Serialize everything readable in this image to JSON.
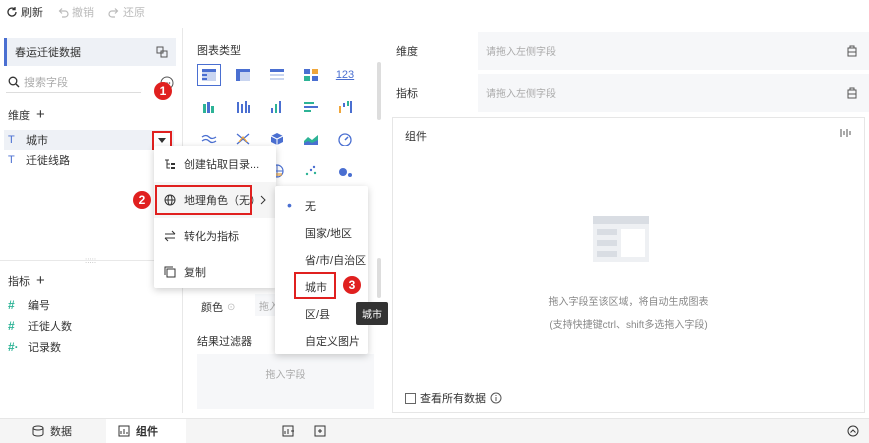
{
  "toolbar": {
    "refresh": "刷新",
    "undo": "撤销",
    "redo": "还原"
  },
  "left": {
    "dataset": "春运迁徙数据",
    "search_placeholder": "搜索字段",
    "dimension_label": "维度",
    "dimensions": [
      "城市",
      "迁徙线路"
    ],
    "metric_label": "指标",
    "metrics": [
      {
        "type": "#",
        "name": "编号"
      },
      {
        "type": "#",
        "name": "迁徙人数"
      },
      {
        "type": "#·",
        "name": "记录数"
      }
    ]
  },
  "chart": {
    "title": "图表类型",
    "color_label": "颜色",
    "drag_short": "拖入",
    "result_filter": "结果过滤器",
    "drag_field": "拖入字段",
    "number_icon": "123"
  },
  "config": {
    "dimension": "维度",
    "metric": "指标",
    "placeholder": "请拖入左侧字段",
    "component": "组件",
    "empty_hint": "拖入字段至该区域，将自动生成图表",
    "empty_hint2": "(支持快捷键ctrl、shift多选拖入字段)",
    "view_all": "查看所有数据"
  },
  "menu": {
    "items": [
      "创建钻取目录...",
      "地理角色（无）",
      "转化为指标",
      "复制"
    ]
  },
  "submenu": {
    "items": [
      "无",
      "国家/地区",
      "省/市/自治区",
      "城市",
      "区/县",
      "自定义图片"
    ],
    "tooltip": "城市"
  },
  "badges": [
    "1",
    "2",
    "3"
  ],
  "bottom": {
    "data_tab": "数据",
    "component_tab": "组件"
  },
  "colors": {
    "accent": "#4a6fd1",
    "badge": "#e0201f",
    "green": "#2db396"
  }
}
